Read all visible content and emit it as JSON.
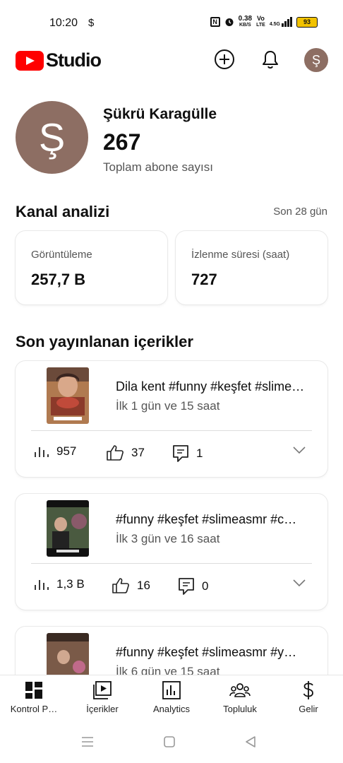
{
  "status_bar": {
    "time": "10:20",
    "dollar": "$",
    "speed_value": "0.38",
    "speed_unit": "KB/S",
    "volte_top": "Vo",
    "volte_bottom": "LTE",
    "signal_label": "4.5G",
    "battery": "93"
  },
  "header": {
    "logo_text": "Studio",
    "avatar_letter": "Ş"
  },
  "channel": {
    "avatar_letter": "Ş",
    "name": "Şükrü Karagülle",
    "subscribers": "267",
    "subscribers_label": "Toplam abone sayısı"
  },
  "analytics": {
    "title": "Kanal analizi",
    "period": "Son 28 gün",
    "metrics": [
      {
        "label": "Görüntüleme",
        "value": "257,7 B"
      },
      {
        "label": "İzlenme süresi (saat)",
        "value": "727"
      }
    ]
  },
  "recent": {
    "title": "Son yayınlanan içerikler",
    "videos": [
      {
        "title": "Dila kent #funny #keşfet #slime…",
        "subtitle": "İlk 1 gün ve 15 saat",
        "views": "957",
        "likes": "37",
        "comments": "1"
      },
      {
        "title": "#funny #keşfet #slimeasmr #c…",
        "subtitle": "İlk 3 gün ve 16 saat",
        "views": "1,3 B",
        "likes": "16",
        "comments": "0"
      },
      {
        "title": "#funny #keşfet #slimeasmr #y…",
        "subtitle": "İlk 6 gün ve 15 saat"
      }
    ]
  },
  "bottom_nav": [
    {
      "label": "Kontrol P…",
      "icon": "dashboard-icon"
    },
    {
      "label": "İçerikler",
      "icon": "content-icon"
    },
    {
      "label": "Analytics",
      "icon": "analytics-icon"
    },
    {
      "label": "Topluluk",
      "icon": "community-icon"
    },
    {
      "label": "Gelir",
      "icon": "dollar-icon"
    }
  ]
}
